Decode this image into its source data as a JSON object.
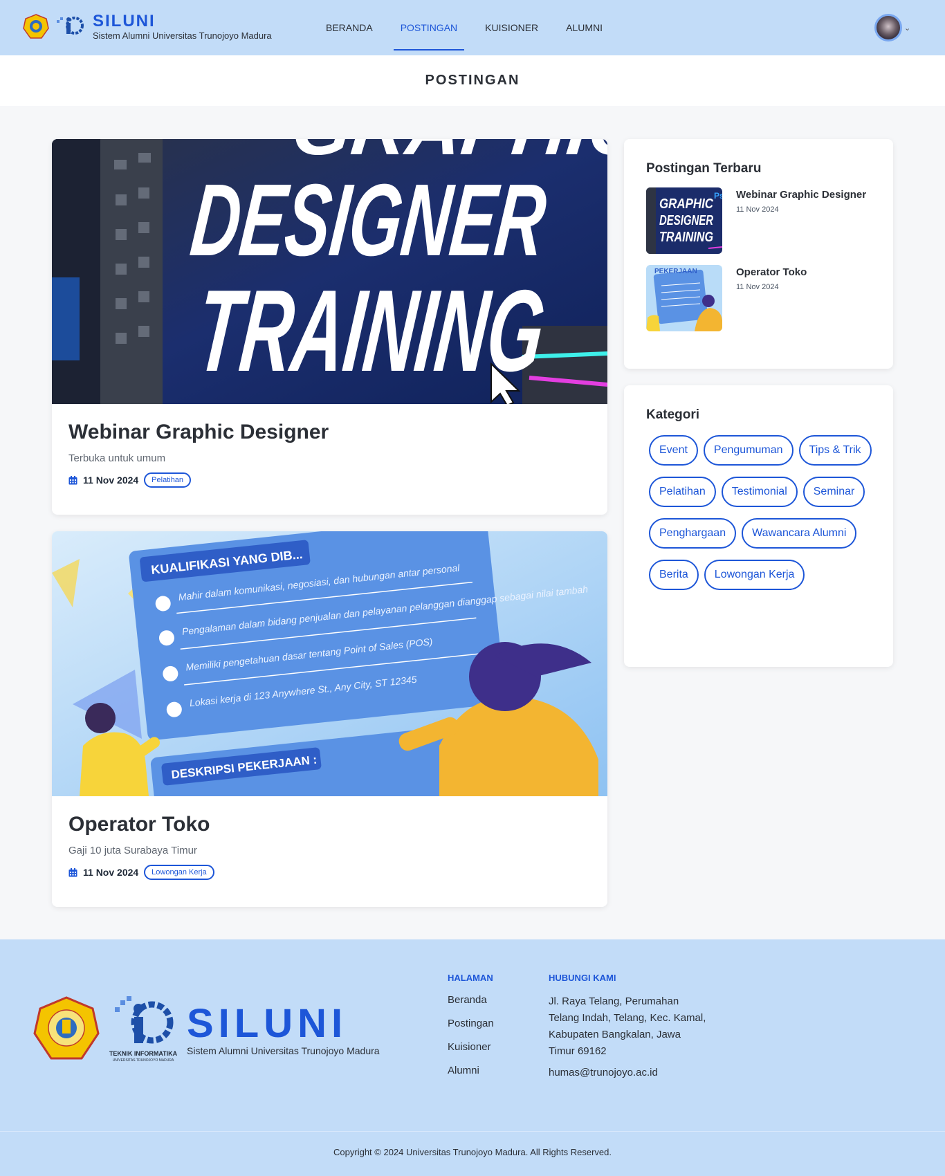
{
  "header": {
    "brand_title": "SILUNI",
    "brand_subtitle": "Sistem Alumni Universitas Trunojoyo Madura",
    "nav": [
      {
        "label": "BERANDA",
        "active": false
      },
      {
        "label": "POSTINGAN",
        "active": true
      },
      {
        "label": "KUISIONER",
        "active": false
      },
      {
        "label": "ALUMNI",
        "active": false
      }
    ]
  },
  "page_title": "POSTINGAN",
  "posts": [
    {
      "title": "Webinar Graphic Designer",
      "subtitle": "Terbuka untuk umum",
      "date": "11 Nov 2024",
      "category": "Pelatihan",
      "image_text": [
        "DESIGNER",
        "TRAINING"
      ]
    },
    {
      "title": "Operator Toko",
      "subtitle": "Gaji 10 juta Surabaya Timur",
      "date": "11 Nov 2024",
      "category": "Lowongan Kerja",
      "image_text": [
        "KUALIFIKASI YANG DIB...",
        "Mahir dalam komunikasi, negosiasi, dan hubungan antar personal",
        "Pengalaman dalam bidang penjualan dan pelayanan pelanggan dianggap sebagai nilai tambah",
        "Memiliki pengetahuan dasar tentang Point of Sales (POS)",
        "Lokasi kerja di 123 Anywhere St., Any City, ST 12345",
        "DESKRIPSI PEKERJAAN :"
      ]
    }
  ],
  "sidebar": {
    "recent_heading": "Postingan Terbaru",
    "recent": [
      {
        "title": "Webinar Graphic Designer",
        "date": "11 Nov 2024",
        "thumb_text": "GRAPHIC DESIGNER TRAINING"
      },
      {
        "title": "Operator Toko",
        "date": "11 Nov 2024",
        "thumb_text": "PEKERJAAN"
      }
    ],
    "category_heading": "Kategori",
    "categories": [
      "Event",
      "Pengumuman",
      "Tips & Trik",
      "Pelatihan",
      "Testimonial",
      "Seminar",
      "Penghargaan",
      "Wawancara Alumni",
      "Berita",
      "Lowongan Kerja"
    ]
  },
  "footer": {
    "brand_title": "SILUNI",
    "brand_subtitle": "Sistem Alumni Universitas Trunojoyo Madura",
    "ti_label": "TEKNIK INFORMATIKA",
    "ti_sublabel": "UNIVERSITAS TRUNOJOYO MADURA",
    "pages_heading": "HALAMAN",
    "pages": [
      "Beranda",
      "Postingan",
      "Kuisioner",
      "Alumni"
    ],
    "contact_heading": "HUBUNGI KAMI",
    "address": "Jl. Raya Telang, Perumahan Telang Indah, Telang, Kec. Kamal, Kabupaten Bangkalan, Jawa Timur 69162",
    "email": "humas@trunojoyo.ac.id",
    "copyright": "Copyright © 2024 Universitas Trunojoyo Madura. All Rights Reserved."
  },
  "colors": {
    "accent": "#1d56d8",
    "header_bg": "#c2dcf8",
    "page_bg": "#f6f7f9"
  }
}
